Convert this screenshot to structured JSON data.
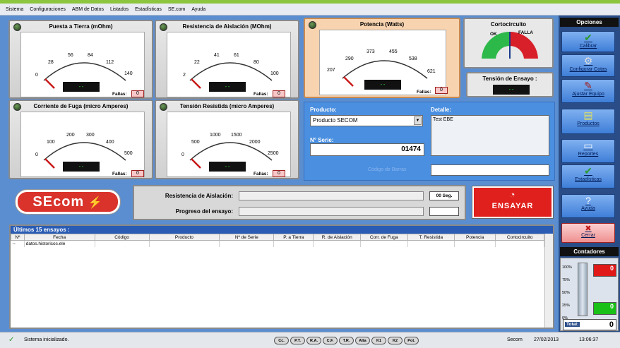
{
  "menu": [
    "Sistema",
    "Configuraciones",
    "ABM de Datos",
    "Listados",
    "Estadísticas",
    "SE.com",
    "Ayuda"
  ],
  "gauges": {
    "tierra": {
      "title": "Puesta a Tierra (mOhm)",
      "ticks": [
        "0",
        "28",
        "56",
        "84",
        "112",
        "140"
      ],
      "display": "--",
      "fallas": "Fallas:",
      "fallas_value": "0"
    },
    "aislacion": {
      "title": "Resistencia de Aislación (MOhm)",
      "ticks": [
        "2",
        "22",
        "41",
        "61",
        "80",
        "100"
      ],
      "display": "--",
      "fallas": "Fallas:",
      "fallas_value": "0"
    },
    "fuga": {
      "title": "Corriente de Fuga (micro Amperes)",
      "ticks": [
        "0",
        "100",
        "200",
        "300",
        "400",
        "500"
      ],
      "display": "--",
      "fallas": "Fallas:",
      "fallas_value": "0"
    },
    "tension": {
      "title": "Tensión Resistida (micro Amperes)",
      "ticks": [
        "0",
        "500",
        "1000",
        "1500",
        "2000",
        "2500"
      ],
      "display": "--",
      "fallas": "Fallas:",
      "fallas_value": "0"
    },
    "potencia": {
      "title": "Potencia (Watts)",
      "ticks": [
        "207",
        "290",
        "373",
        "455",
        "538",
        "621"
      ],
      "display": "--",
      "fallas": "Fallas:",
      "fallas_value": "0"
    }
  },
  "cortocircuito": {
    "title": "Cortocircuito",
    "ok": "OK",
    "falla": "FALLA"
  },
  "tension_ensayo": {
    "title": "Tensión de Ensayo :",
    "display": "--"
  },
  "producto": {
    "label": "Producto:",
    "value": "Producto SECOM",
    "serie_label": "N° Serie:",
    "serie_value": "01474",
    "detalle_label": "Detalle:",
    "detalle_value": "Test EBE",
    "codigo_label": "Código de Barras"
  },
  "logo": "SEcom",
  "progress": {
    "aislacion_label": "Resistencia de Aislación:",
    "seg": "00 Seg.",
    "progreso_label": "Progreso del ensayo:"
  },
  "ensayar": "ENSAYAR",
  "history": {
    "title": "Últimos 15 ensayos :",
    "columns": [
      "Nº",
      "Fecha",
      "Código",
      "Producto",
      "Nº de Serie",
      "P. a Tierra",
      "R. de Aislación",
      "Corr. de Fuga",
      "T. Resistida",
      "Potencia",
      "Cortocircuito"
    ],
    "rows": [
      [
        "--",
        "datos.historicos.ele",
        "",
        "",
        "",
        "",
        "",
        "",
        "",
        "",
        ""
      ]
    ]
  },
  "opciones": {
    "title": "Opciones",
    "buttons": [
      {
        "label": "Calibrar",
        "icon": "check-icon"
      },
      {
        "label": "Configurar Cotas",
        "icon": "gear-icon"
      },
      {
        "label": "Ajustar Equipo",
        "icon": "tools-icon"
      },
      {
        "label": "Productos",
        "icon": "products-icon"
      },
      {
        "label": "Reportes",
        "icon": "report-icon"
      },
      {
        "label": "Estadísticas",
        "icon": "stats-icon"
      },
      {
        "label": "Ayuda",
        "icon": "help-icon"
      },
      {
        "label": "Cerrar",
        "icon": "close-icon"
      }
    ]
  },
  "contadores": {
    "title": "Contadores",
    "scale": [
      "100%",
      "75%",
      "50%",
      "25%",
      "0%"
    ],
    "bad": "0",
    "good": "0",
    "total_label": "Total:",
    "total": "0"
  },
  "status": {
    "text": "Sistema inicializado.",
    "pills": [
      "Cc.",
      "P.T.",
      "R.A.",
      "C.F.",
      "T.R.",
      "Alta",
      "K1",
      "K2",
      "Pot."
    ],
    "company": "Secom",
    "date": "27/02/2013",
    "time": "13:06:37"
  },
  "colors": {
    "accent": "#8cc63f",
    "main_bg": "#5b8ed0",
    "logo_red": "#d9332b",
    "ensayar_red": "#e0201c"
  }
}
